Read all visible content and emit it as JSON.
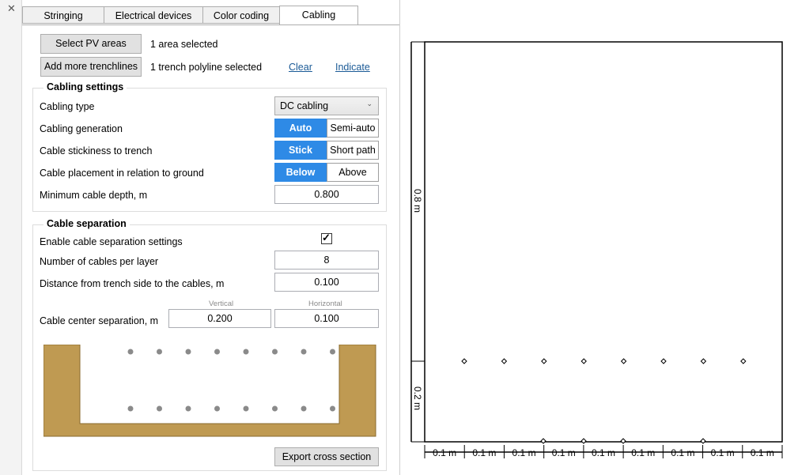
{
  "tabs": [
    "Stringing",
    "Electrical devices",
    "Color coding",
    "Cabling"
  ],
  "actions": {
    "select_pv_label": "Select PV areas",
    "selected_areas": "1 area selected",
    "add_trench_label": "Add more trenchlines",
    "trench_selected": "1 trench polyline selected",
    "clear_label": "Clear",
    "indicate_label": "Indicate"
  },
  "cabling_settings": {
    "title": "Cabling settings",
    "type_label": "Cabling type",
    "type_value": "DC cabling",
    "generation_label": "Cabling generation",
    "generation_options": [
      "Auto",
      "Semi-auto"
    ],
    "stickiness_label": "Cable stickiness to trench",
    "stickiness_options": [
      "Stick",
      "Short path"
    ],
    "placement_label": "Cable placement in relation to ground",
    "placement_options": [
      "Below",
      "Above"
    ],
    "depth_label": "Minimum cable depth, m",
    "depth_value": "0.800"
  },
  "cable_separation": {
    "title": "Cable separation",
    "enable_label": "Enable cable separation settings",
    "enable_checked": true,
    "cables_per_layer_label": "Number of cables per layer",
    "cables_per_layer_value": "8",
    "distance_label": "Distance from trench side to the cables, m",
    "distance_value": "0.100",
    "center_sep_label": "Cable center separation, m",
    "vertical_label": "Vertical",
    "vertical_value": "0.200",
    "horizontal_label": "Horizontal",
    "horizontal_value": "0.100",
    "export_label": "Export cross section"
  },
  "cross_section": {
    "depth_dimension": "0.8 m",
    "layer_dimension": "0.2 m",
    "spacing_label": "0.1 m",
    "spacing_count": 9
  },
  "colors": {
    "accent": "#2e8ae6",
    "soil": "#bf9a52",
    "link": "#1a5a96"
  },
  "icons": [
    "close-icon",
    "chevron-down-icon",
    "check-icon"
  ]
}
